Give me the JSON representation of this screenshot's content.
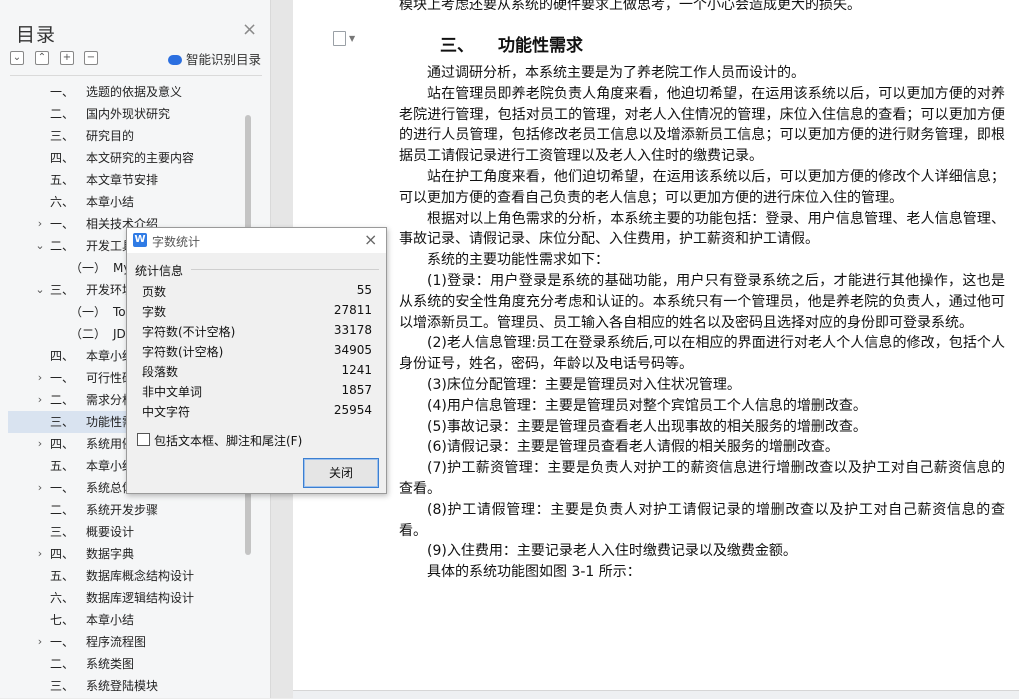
{
  "toc": {
    "title": "目录",
    "close_icon": "×",
    "smart_label": "智能识别目录",
    "items": [
      {
        "arrow": "",
        "num": "一、",
        "text": "选题的依据及意义",
        "level": 1
      },
      {
        "arrow": "",
        "num": "二、",
        "text": "国内外现状研究",
        "level": 1
      },
      {
        "arrow": "",
        "num": "三、",
        "text": "研究目的",
        "level": 1
      },
      {
        "arrow": "",
        "num": "四、",
        "text": "本文研究的主要内容",
        "level": 1
      },
      {
        "arrow": "",
        "num": "五、",
        "text": "本文章节安排",
        "level": 1
      },
      {
        "arrow": "",
        "num": "六、",
        "text": "本章小结",
        "level": 1
      },
      {
        "arrow": "›",
        "num": "一、",
        "text": "相关技术介绍",
        "level": 1
      },
      {
        "arrow": "⌄",
        "num": "二、",
        "text": "开发工具",
        "level": 1
      },
      {
        "arrow": "",
        "num": "（一）",
        "text": "MyEclipse",
        "level": 2
      },
      {
        "arrow": "⌄",
        "num": "三、",
        "text": "开发环境",
        "level": 1
      },
      {
        "arrow": "",
        "num": "（一）",
        "text": "Tomcat",
        "level": 2
      },
      {
        "arrow": "",
        "num": "（二）",
        "text": "JDK",
        "level": 2
      },
      {
        "arrow": "",
        "num": "四、",
        "text": "本章小结",
        "level": 1
      },
      {
        "arrow": "›",
        "num": "一、",
        "text": "可行性研究",
        "level": 1
      },
      {
        "arrow": "›",
        "num": "二、",
        "text": "需求分析",
        "level": 1
      },
      {
        "arrow": "",
        "num": "三、",
        "text": "功能性需求",
        "level": 1,
        "active": true
      },
      {
        "arrow": "›",
        "num": "四、",
        "text": "系统用例图",
        "level": 1
      },
      {
        "arrow": "",
        "num": "五、",
        "text": "本章小结",
        "level": 1
      },
      {
        "arrow": "›",
        "num": "一、",
        "text": "系统总体设计",
        "level": 1
      },
      {
        "arrow": "",
        "num": "二、",
        "text": "系统开发步骤",
        "level": 1
      },
      {
        "arrow": "",
        "num": "三、",
        "text": "概要设计",
        "level": 1
      },
      {
        "arrow": "›",
        "num": "四、",
        "text": "数据字典",
        "level": 1
      },
      {
        "arrow": "",
        "num": "五、",
        "text": "数据库概念结构设计",
        "level": 1
      },
      {
        "arrow": "",
        "num": "六、",
        "text": "数据库逻辑结构设计",
        "level": 1
      },
      {
        "arrow": "",
        "num": "七、",
        "text": "本章小结",
        "level": 1
      },
      {
        "arrow": "›",
        "num": "一、",
        "text": "程序流程图",
        "level": 1
      },
      {
        "arrow": "",
        "num": "二、",
        "text": "系统类图",
        "level": 1
      },
      {
        "arrow": "",
        "num": "三、",
        "text": "系统登陆模块",
        "level": 1
      }
    ]
  },
  "doc": {
    "prev_line": "模块上考虑还要从系统的硬件要求上做思考，一个小心会造成更大的损失。",
    "heading_num": "三、",
    "heading_text": "功能性需求",
    "paragraphs": [
      "通过调研分析，本系统主要是为了养老院工作人员而设计的。",
      "站在管理员即养老院负责人角度来看，他迫切希望，在运用该系统以后，可以更加方便的对养老院进行管理，包括对员工的管理，对老人入住情况的管理，床位入住信息的查看；可以更加方便的进行人员管理，包括修改老员工信息以及增添新员工信息；可以更加方便的进行财务管理，即根据员工请假记录进行工资管理以及老人入住时的缴费记录。",
      "站在护工角度来看，他们迫切希望，在运用该系统以后，可以更加方便的修改个人详细信息；可以更加方便的查看自己负责的老人信息；可以更加方便的进行床位入住的管理。",
      "根据对以上角色需求的分析，本系统主要的功能包括：登录、用户信息管理、老人信息管理、事故记录、请假记录、床位分配、入住费用，护工薪资和护工请假。",
      "系统的主要功能性需求如下：",
      "(1)登录：用户登录是系统的基础功能，用户只有登录系统之后，才能进行其他操作，这也是从系统的安全性角度充分考虑和认证的。本系统只有一个管理员，他是养老院的负责人，通过他可以增添新员工。管理员、员工输入各自相应的姓名以及密码且选择对应的身份即可登录系统。",
      "(2)老人信息管理:员工在登录系统后,可以在相应的界面进行对老人个人信息的修改，包括个人身份证号，姓名，密码，年龄以及电话号码等。",
      "(3)床位分配管理：主要是管理员对入住状况管理。",
      "(4)用户信息管理：主要是管理员对整个宾馆员工个人信息的增删改查。",
      "(5)事故记录：主要是管理员查看老人出现事故的相关服务的增删改查。",
      "(6)请假记录：主要是管理员查看老人请假的相关服务的增删改查。",
      "(7)护工薪资管理：主要是负责人对护工的薪资信息进行增删改查以及护工对自己薪资信息的查看。",
      "(8)护工请假管理：主要是负责人对护工请假记录的增删改查以及护工对自己薪资信息的查看。",
      "(9)入住费用：主要记录老人入住时缴费记录以及缴费金额。",
      "具体的系统功能图如图 3-1 所示："
    ]
  },
  "dialog": {
    "title": "字数统计",
    "group_label": "统计信息",
    "stats": [
      {
        "label": "页数",
        "value": "55"
      },
      {
        "label": "字数",
        "value": "27811"
      },
      {
        "label": "字符数(不计空格)",
        "value": "33178"
      },
      {
        "label": "字符数(计空格)",
        "value": "34905"
      },
      {
        "label": "段落数",
        "value": "1241"
      },
      {
        "label": "非中文单词",
        "value": "1857"
      },
      {
        "label": "中文字符",
        "value": "25954"
      }
    ],
    "checkbox_label": "包括文本框、脚注和尾注(F)",
    "checkbox_checked": false,
    "close_button": "关闭"
  }
}
